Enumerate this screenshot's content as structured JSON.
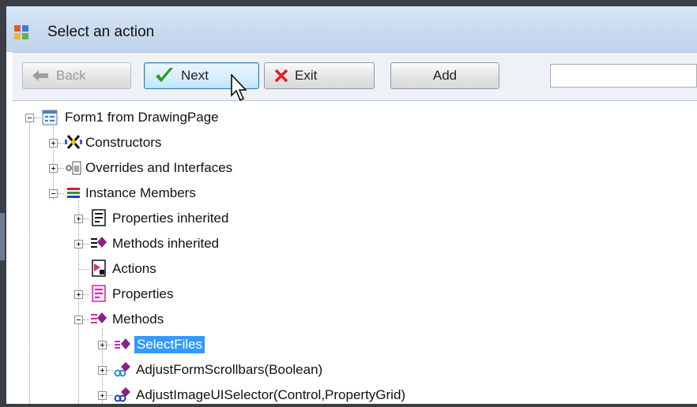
{
  "window": {
    "title": "Select an action"
  },
  "toolbar": {
    "back_label": "Back",
    "next_label": "Next",
    "exit_label": "Exit",
    "add_label": "Add",
    "search_value": ""
  },
  "tree": {
    "root": "Form1 from DrawingPage",
    "constructors": "Constructors",
    "overrides": "Overrides and Interfaces",
    "instance_members": "Instance Members",
    "properties_inherited": "Properties inherited",
    "methods_inherited": "Methods inherited",
    "actions": "Actions",
    "properties": "Properties",
    "methods": "Methods",
    "select_files": "SelectFiles",
    "adjust_form_scrollbars": "AdjustFormScrollbars(Boolean)",
    "adjust_image_ui_selector": "AdjustImageUISelector(Control,PropertyGrid)"
  },
  "colors": {
    "selection": "#3399ff",
    "next_check": "#2e9a1f",
    "exit_x": "#e02020"
  }
}
